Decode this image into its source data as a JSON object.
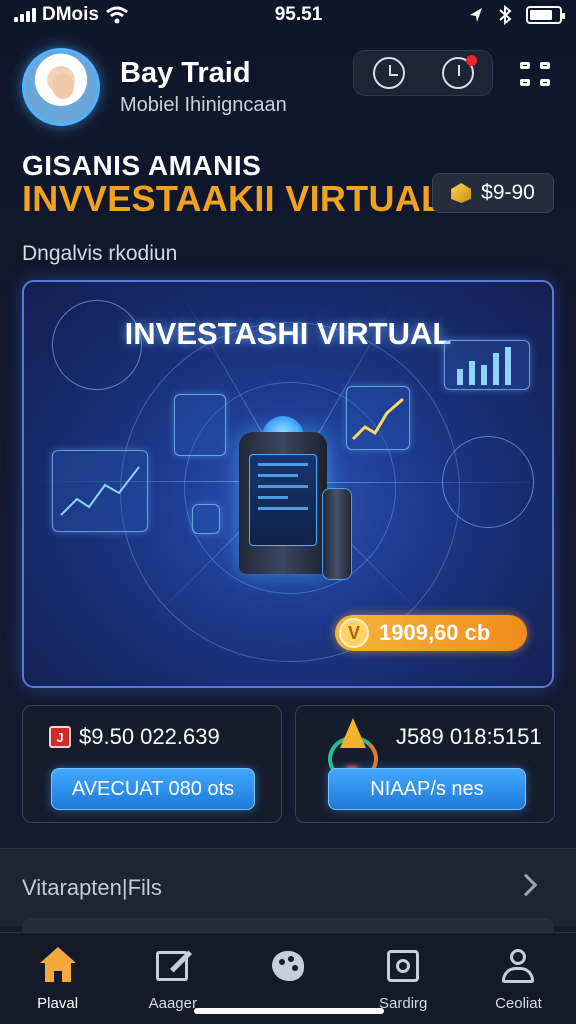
{
  "status_bar": {
    "carrier": "DMois",
    "time": "95.51"
  },
  "profile": {
    "name": "Bay Traid",
    "subtitle": "Mobiel Ihinigncaan"
  },
  "header": {
    "kicker": "GISANIS AMANIS",
    "title": "INVVESTAAKII VIRTUAL",
    "balance": "$9-90",
    "section_label": "Dngalvis rkodiun"
  },
  "hero": {
    "title": "INVESTASHI VIRTUAL",
    "price": "1909,60 cb",
    "badge_letter": "V"
  },
  "stats": [
    {
      "value": "$9.50 022.639",
      "badge": "J",
      "button": "AVECUAT 080 ots"
    },
    {
      "value": "J589 018:5151",
      "button": "NIAAP/s nes"
    }
  ],
  "list_row": {
    "label": "Vitarapten|Fils"
  },
  "tabs": [
    {
      "label": "Plaval",
      "icon": "home-icon",
      "active": true
    },
    {
      "label": "Aaager",
      "icon": "edit-icon",
      "active": false
    },
    {
      "label": "",
      "icon": "palette-icon",
      "active": false
    },
    {
      "label": "Sardirg",
      "icon": "store-icon",
      "active": false
    },
    {
      "label": "Ceoliat",
      "icon": "user-icon",
      "active": false
    }
  ],
  "colors": {
    "accent_orange": "#f1a21f",
    "accent_blue": "#42a8ff",
    "notification_red": "#e8242f",
    "background": "#10162a"
  }
}
